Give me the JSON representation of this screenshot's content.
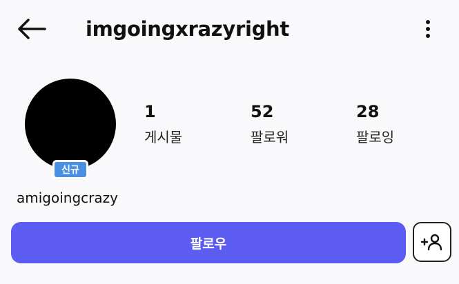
{
  "header": {
    "username": "imgoingxrazyright",
    "back_icon": "arrow-left-icon",
    "menu_icon": "more-vertical-icon"
  },
  "profile": {
    "badge": "신규",
    "display_name": "amigoingcrazy",
    "stats": [
      {
        "value": "1",
        "label": "게시물"
      },
      {
        "value": "52",
        "label": "팔로워"
      },
      {
        "value": "28",
        "label": "팔로잉"
      }
    ]
  },
  "actions": {
    "follow_label": "팔로우",
    "add_friend_icon": "add-user-icon"
  },
  "colors": {
    "follow_button": "#5c5cf2",
    "badge": "#4a90e2",
    "avatar": "#000000"
  }
}
